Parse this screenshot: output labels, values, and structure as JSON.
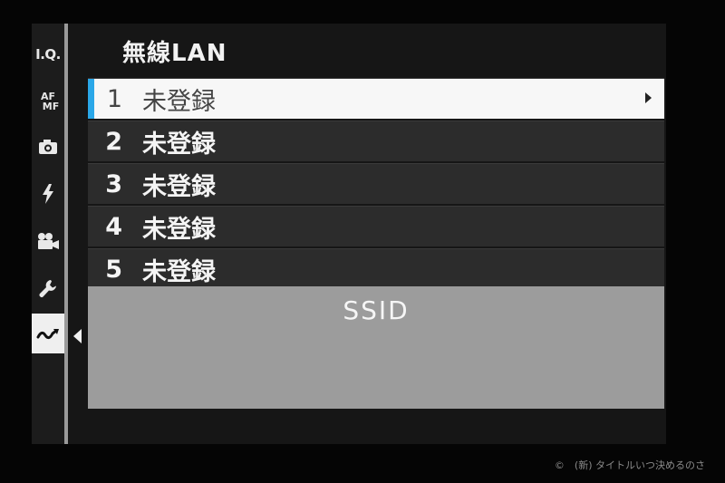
{
  "sidebar": {
    "tabs": [
      {
        "label": "I.Q.",
        "icon": "iq-icon"
      },
      {
        "label_top": "AF",
        "label_bottom": "MF",
        "icon": "af-mf-icon"
      },
      {
        "icon": "camera-icon"
      },
      {
        "icon": "flash-icon"
      },
      {
        "icon": "movie-camera-icon"
      },
      {
        "icon": "wrench-icon"
      },
      {
        "icon": "wireless-icon",
        "active": true
      }
    ]
  },
  "menu": {
    "title": "無線LAN",
    "items": [
      {
        "number": "1",
        "label": "未登録",
        "selected": true
      },
      {
        "number": "2",
        "label": "未登録"
      },
      {
        "number": "3",
        "label": "未登録"
      },
      {
        "number": "4",
        "label": "未登録"
      },
      {
        "number": "5",
        "label": "未登録"
      }
    ]
  },
  "info": {
    "label": "SSID"
  },
  "watermark": "©　(新) タイトルいつ決めるのさ",
  "colors": {
    "selection_accent": "#2aa7e8",
    "selected_row_bg": "#f7f7f7",
    "row_bg": "#2c2c2c",
    "info_panel_bg": "#9c9c9c"
  }
}
